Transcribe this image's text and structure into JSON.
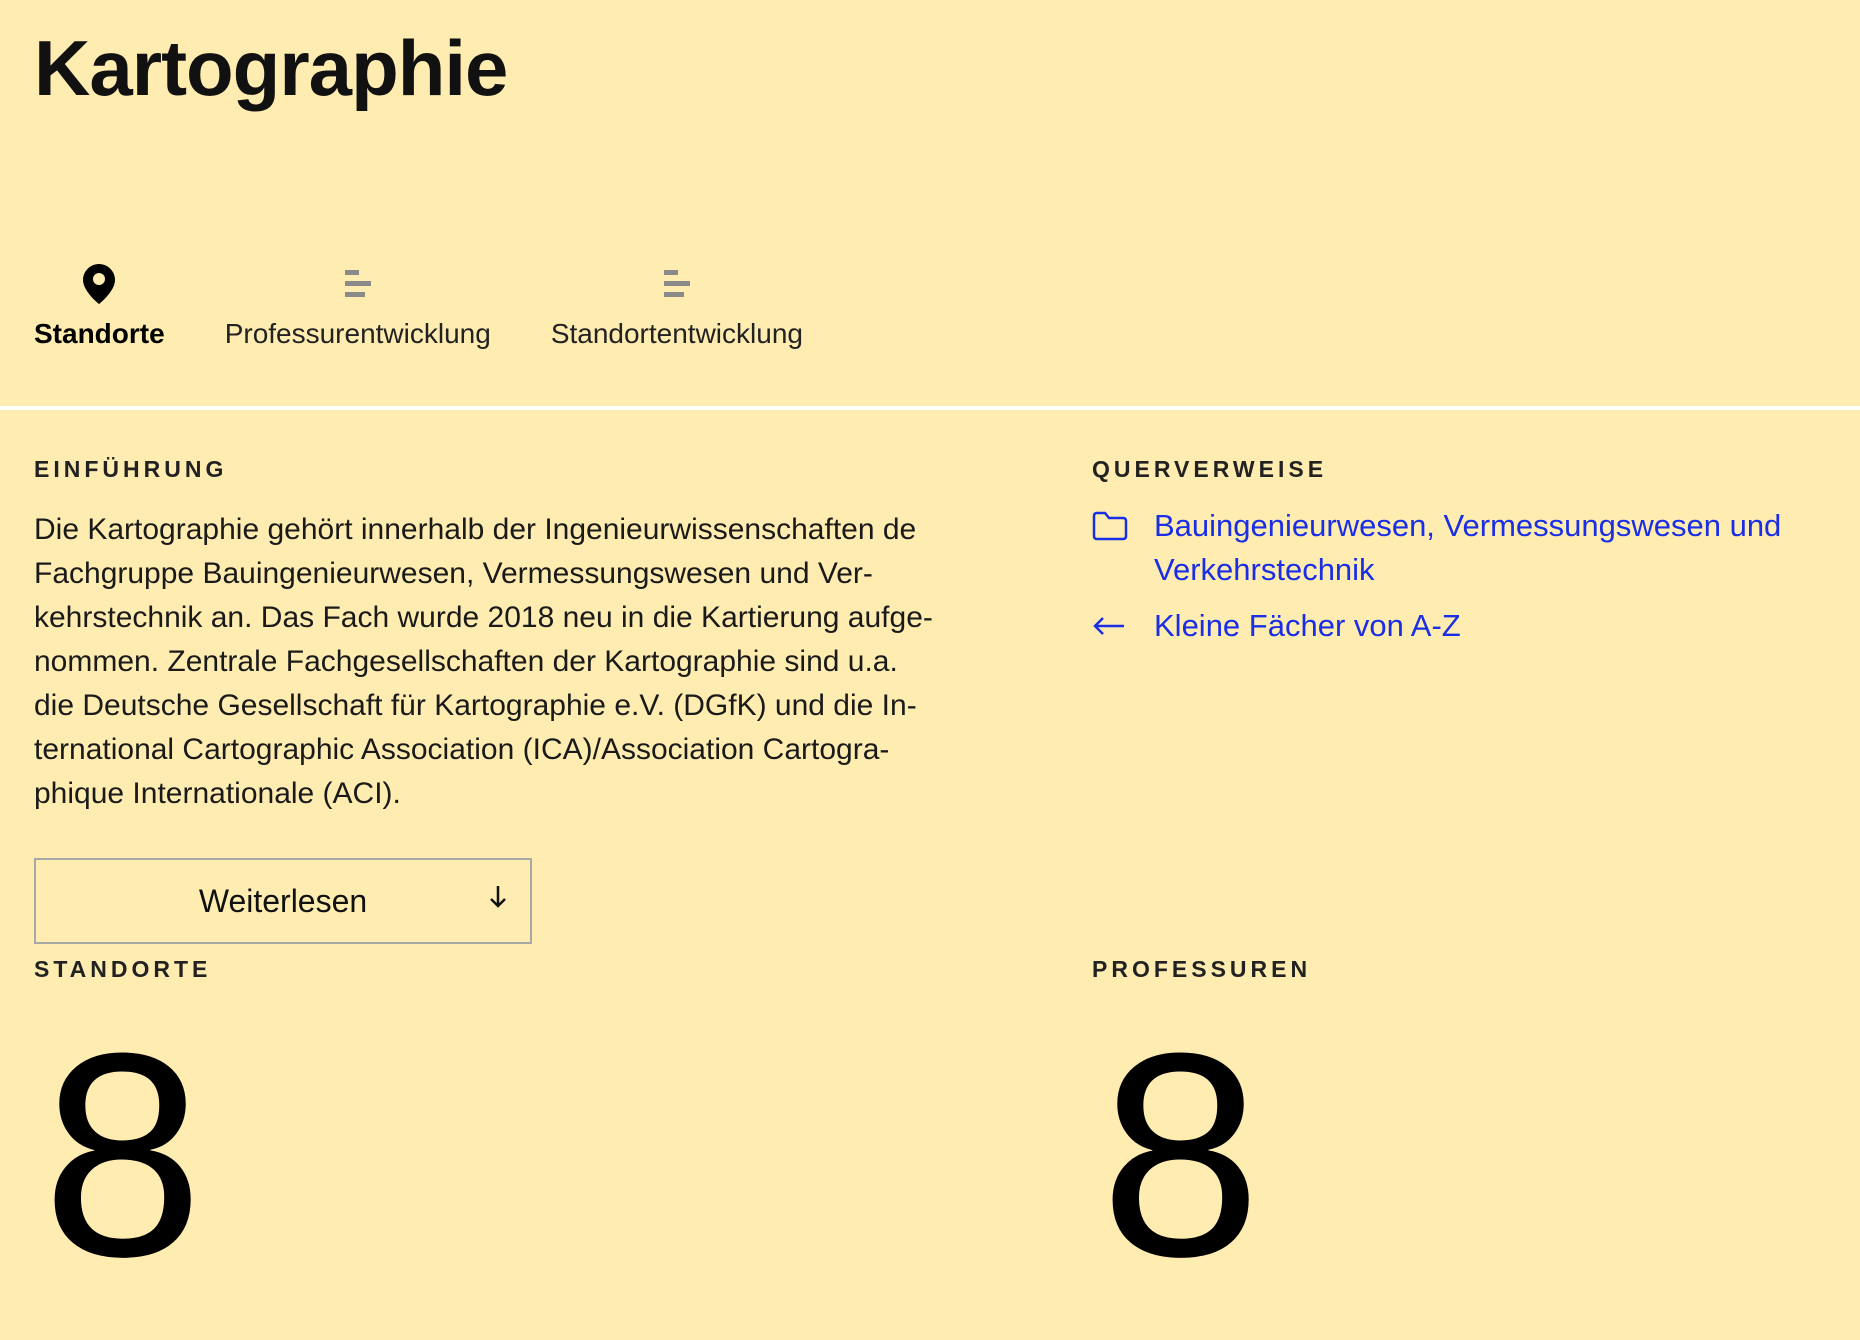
{
  "page": {
    "title": "Kartographie"
  },
  "tabs": [
    {
      "label": "Standorte",
      "icon": "location-pin-icon",
      "active": true
    },
    {
      "label": "Professurentwicklung",
      "icon": "bar-chart-icon",
      "active": false
    },
    {
      "label": "Standortentwicklung",
      "icon": "bar-chart-icon",
      "active": false
    }
  ],
  "intro": {
    "heading": "EINFÜHRUNG",
    "text": "Die Kartographie gehört innerhalb der Ingenieurwissenschaften de\nFachgruppe Bauingenieurwesen, Vermessungswesen und Ver-\nkehrstechnik an. Das Fach wurde 2018 neu in die Kartierung aufge-\nnommen. Zentrale Fachgesellschaften der Kartographie sind u.a.\ndie Deutsche Gesellschaft für Kartographie e.V. (DGfK) und die In-\nternational Cartographic Association (ICA)/Association Cartogra-\nphique Internationale (ACI).",
    "more_label": "Weiterlesen",
    "more_icon": "arrow-down-icon"
  },
  "references": {
    "heading": "QUERVERWEISE",
    "items": [
      {
        "label": "Bauingenieurwesen, Vermessungswesen und Verkehrstechnik",
        "icon": "folder-icon"
      },
      {
        "label": "Kleine Fächer von A-Z",
        "icon": "arrow-left-icon"
      }
    ]
  },
  "stats": {
    "locations": {
      "heading": "STANDORTE",
      "value": "8"
    },
    "professorships": {
      "heading": "PROFESSUREN",
      "value": "8"
    }
  },
  "colors": {
    "background": "#feecb0",
    "link": "#1a2ee6",
    "divider": "#ffffff",
    "icon_muted": "#8a8a8a"
  }
}
